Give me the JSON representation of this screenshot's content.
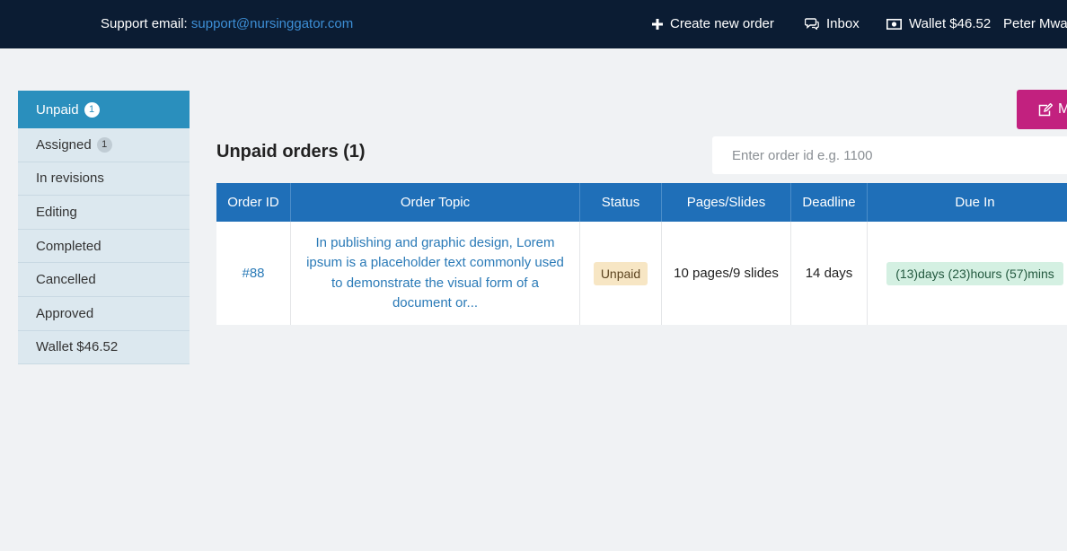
{
  "topbar": {
    "support_label": "Support email:",
    "support_email": "support@nursinggator.com",
    "create_order": "Create new order",
    "inbox": "Inbox",
    "wallet": "Wallet $46.52",
    "user_name": "Peter Mwa"
  },
  "sidebar": {
    "items": [
      {
        "label": "Unpaid",
        "badge": "1"
      },
      {
        "label": "Assigned",
        "badge": "1"
      },
      {
        "label": "In revisions"
      },
      {
        "label": "Editing"
      },
      {
        "label": "Completed"
      },
      {
        "label": "Cancelled"
      },
      {
        "label": "Approved"
      },
      {
        "label": "Wallet $46.52"
      }
    ]
  },
  "main": {
    "action_button": "M",
    "title": "Unpaid orders (1)",
    "search_placeholder": "Enter order id e.g. 1100"
  },
  "table": {
    "headers": [
      "Order ID",
      "Order Topic",
      "Status",
      "Pages/Slides",
      "Deadline",
      "Due In"
    ],
    "rows": [
      {
        "order_id": "#88",
        "topic": "In publishing and graphic design, Lorem ipsum is a placeholder text commonly used to demonstrate the visual form of a document or...",
        "status": "Unpaid",
        "pages": "10 pages/9 slides",
        "deadline": "14 days",
        "due_in": "(13)days (23)hours (57)mins"
      }
    ]
  },
  "colors": {
    "topbar": "#0b1c33",
    "accent": "#2a8fbd",
    "table_header": "#1f6fb8",
    "action_button": "#c2217f"
  }
}
